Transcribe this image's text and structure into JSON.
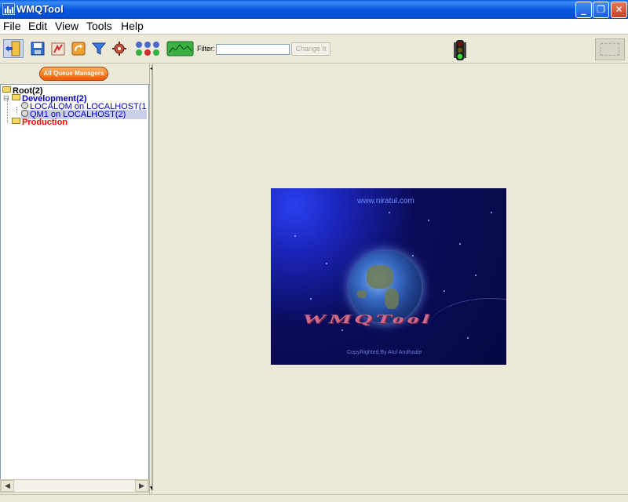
{
  "window": {
    "title": "WMQTool"
  },
  "menu": [
    "File",
    "Edit",
    "View",
    "Tools",
    "Help"
  ],
  "toolbar": {
    "buttons": [
      {
        "name": "exit-icon"
      },
      {
        "name": "save-icon"
      },
      {
        "name": "wizard-icon"
      },
      {
        "name": "refresh-icon"
      },
      {
        "name": "filter-icon"
      },
      {
        "name": "settings-icon"
      },
      {
        "name": "status-grid-icon"
      },
      {
        "name": "monitor-icon"
      }
    ],
    "filter_label": "Filter:",
    "filter_value": "",
    "change_label": "Change It"
  },
  "left_panel": {
    "all_queue_managers_label": "All Queue Managers",
    "tree": {
      "root": "Root(2)",
      "development": "Development(2)",
      "qm1": "LOCALQM on LOCALHOST(1",
      "qm2": "QM1 on LOCALHOST(2)",
      "production": "Production"
    }
  },
  "splash": {
    "url": "www.niratul.com",
    "logo": "WMQTool",
    "copyright": "CopyRighted By Atul Andhaale"
  },
  "colors": {
    "accent_orange": "#ee5a00",
    "tree_blue": "#0000cc",
    "tree_red": "#ff0000",
    "selected_bg": "#c8cfe6"
  }
}
